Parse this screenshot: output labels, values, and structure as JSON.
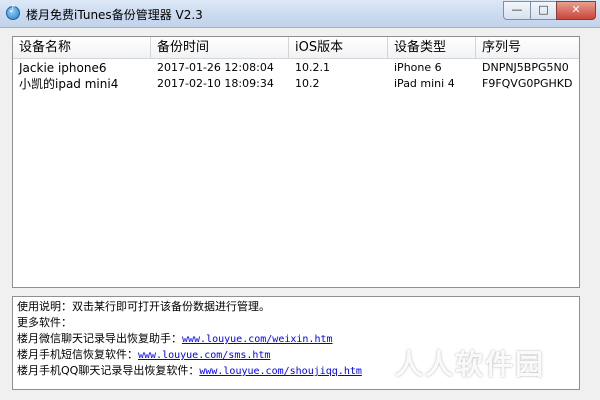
{
  "window": {
    "title": "楼月免费iTunes备份管理器 V2.3",
    "minimize_glyph": "—",
    "maximize_glyph": "□",
    "close_glyph": "✕"
  },
  "table": {
    "columns": [
      "设备名称",
      "备份时间",
      "iOS版本",
      "设备类型",
      "序列号"
    ],
    "rows": [
      [
        "Jackie iphone6",
        "2017-01-26 12:08:04",
        "10.2.1",
        "iPhone 6",
        "DNPNJ5BPG5N0"
      ],
      [
        "小凯的ipad mini4",
        "2017-02-10 18:09:34",
        "10.2",
        "iPad mini 4",
        "F9FQVG0PGHKD"
      ]
    ]
  },
  "info": {
    "usage": "使用说明：双击某行即可打开该备份数据进行管理。",
    "more": "更多软件：",
    "items": [
      {
        "label": "楼月微信聊天记录导出恢复助手：",
        "url": "www.louyue.com/weixin.htm"
      },
      {
        "label": "楼月手机短信恢复软件：",
        "url": "www.louyue.com/sms.htm"
      },
      {
        "label": "楼月手机QQ聊天记录导出恢复软件：",
        "url": "www.louyue.com/shoujiqq.htm"
      }
    ]
  },
  "watermark": "人人软件园"
}
